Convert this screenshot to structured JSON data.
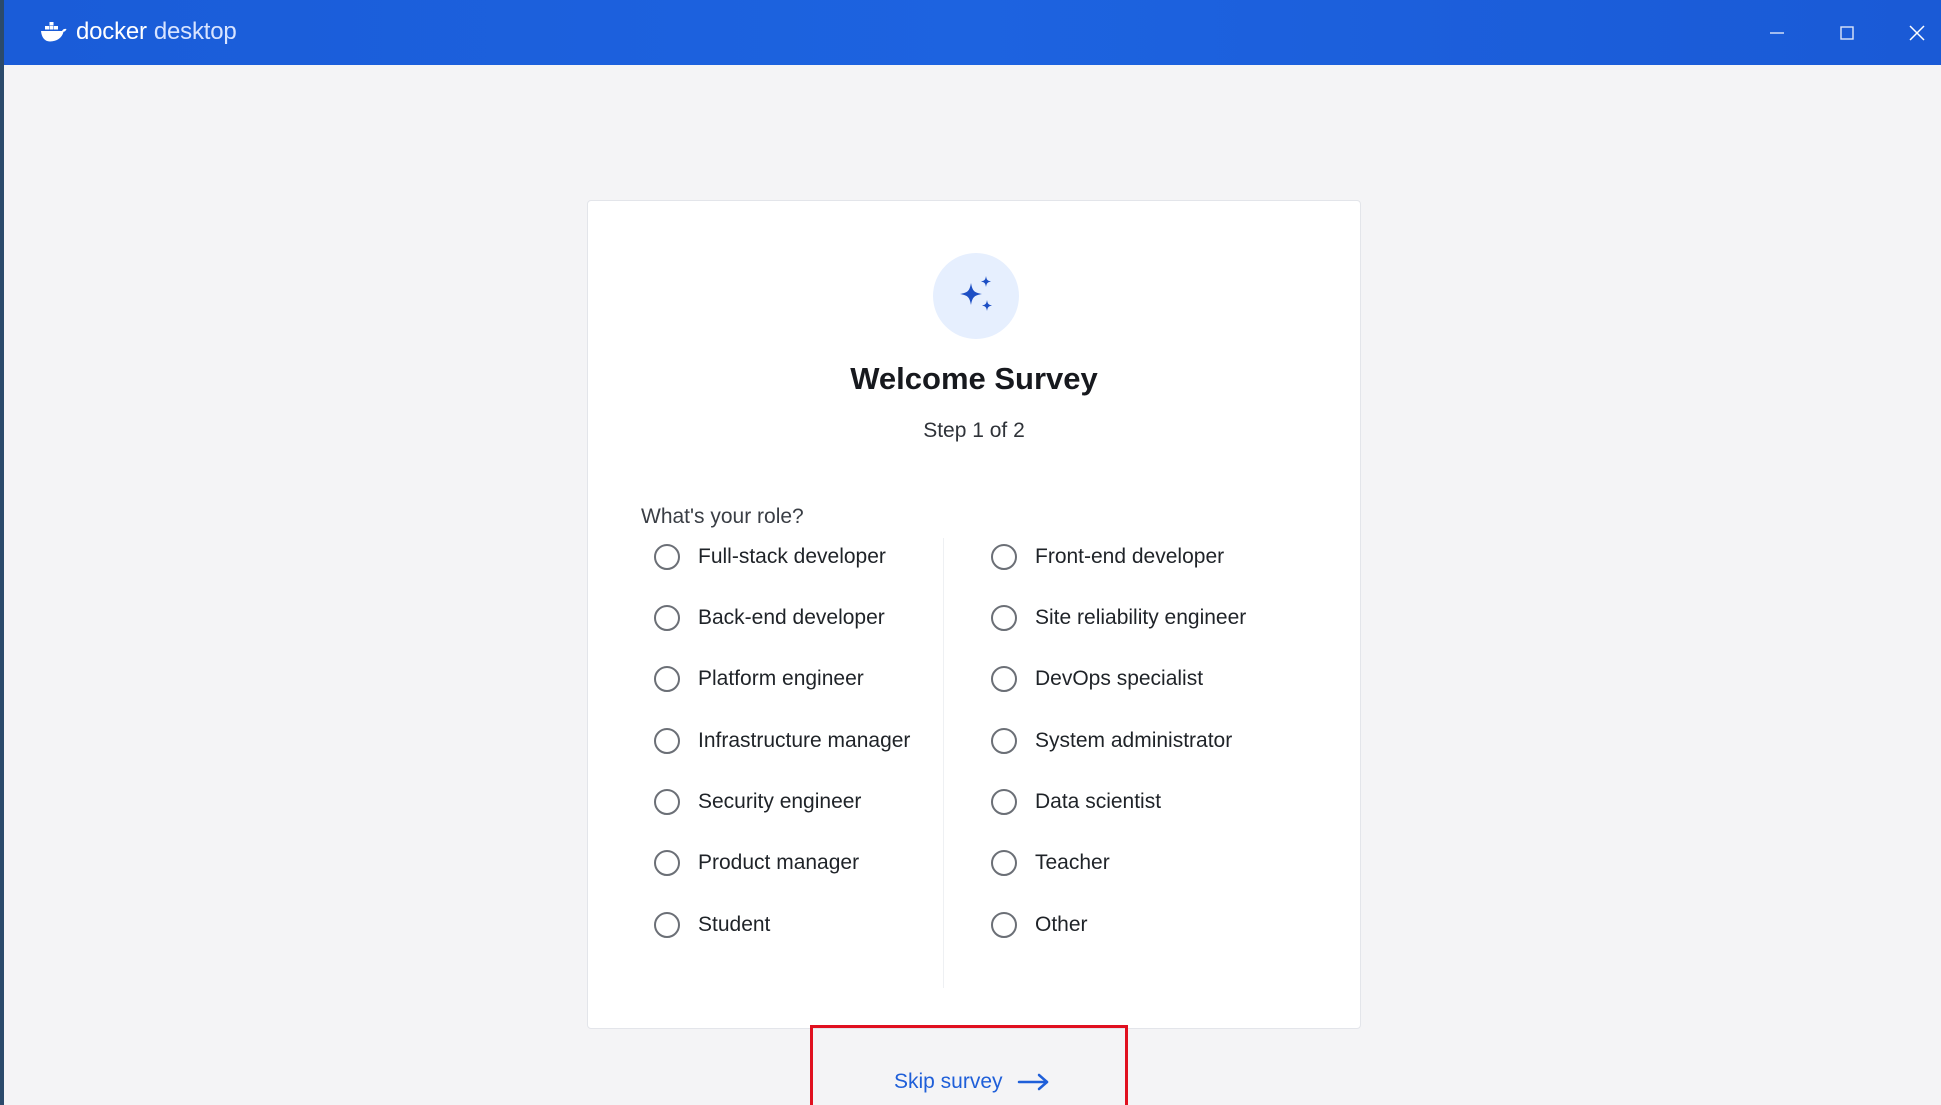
{
  "window": {
    "app_name_primary": "docker",
    "app_name_secondary": "desktop",
    "controls": {
      "minimize_icon": "minimize-icon",
      "maximize_icon": "maximize-icon",
      "close_icon": "close-icon"
    }
  },
  "survey": {
    "icon": "sparkles-icon",
    "title": "Welcome Survey",
    "step": "Step 1 of 2",
    "question": "What's your role?",
    "options": [
      "Full-stack developer",
      "Front-end developer",
      "Back-end developer",
      "Site reliability engineer",
      "Platform engineer",
      "DevOps specialist",
      "Infrastructure manager",
      "System administrator",
      "Security engineer",
      "Data scientist",
      "Product manager",
      "Teacher",
      "Student",
      "Other"
    ],
    "skip_label": "Skip survey"
  },
  "colors": {
    "titlebar": "#1d63e0",
    "accent": "#1f5fd9",
    "highlight_border": "#e0101f"
  }
}
